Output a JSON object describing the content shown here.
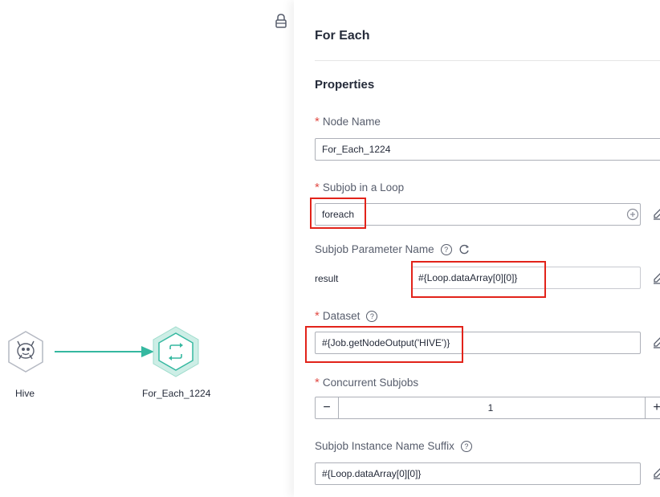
{
  "canvas": {
    "nodes": [
      {
        "label": "Hive",
        "icon": "hive-icon"
      },
      {
        "label": "For_Each_1224",
        "icon": "loop-icon"
      }
    ]
  },
  "panel": {
    "title": "For Each",
    "section": "Properties",
    "node_name": {
      "label": "Node Name",
      "required_mark": "*",
      "value": "For_Each_1224"
    },
    "subjob": {
      "label": "Subjob in a Loop",
      "required_mark": "*",
      "value": "foreach"
    },
    "param": {
      "label": "Subjob Parameter Name",
      "help": "?",
      "key": "result",
      "value": "#{Loop.dataArray[0][0]}"
    },
    "dataset": {
      "label": "Dataset",
      "required_mark": "*",
      "help": "?",
      "value": "#{Job.getNodeOutput('HIVE')}"
    },
    "concurrent": {
      "label": "Concurrent Subjobs",
      "required_mark": "*",
      "value": "1",
      "minus": "−",
      "plus": "+"
    },
    "suffix": {
      "label": "Subjob Instance Name Suffix",
      "help": "?",
      "value": "#{Loop.dataArray[0][0]}"
    }
  },
  "colors": {
    "accent": "#35b8a0",
    "required": "#e14c46",
    "highlight": "#e2231a"
  }
}
